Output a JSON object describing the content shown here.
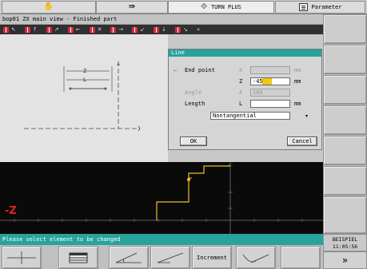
{
  "top_tabs": [
    {
      "icon": "hand-icon",
      "label": ""
    },
    {
      "icon": "program-icon",
      "label": ""
    },
    {
      "icon": "cycle-icon",
      "label": "TURN PLUS"
    },
    {
      "icon": "document-icon",
      "label": "Parameter"
    }
  ],
  "title_line": "bop01  ZX main view - Finished part",
  "dialog": {
    "title": "Line",
    "rows": [
      {
        "label": "End point",
        "letter": "X",
        "value": "",
        "unit": "mm",
        "dim": true
      },
      {
        "label": "",
        "letter": "Z",
        "value": "-45",
        "unit": "mm",
        "dim": false
      },
      {
        "label": "Angle",
        "letter": "A",
        "value": "180",
        "unit": "",
        "dim": true
      },
      {
        "label": "Length",
        "letter": "L",
        "value": "",
        "unit": "mm",
        "dim": false
      }
    ],
    "select_value": "Nontangential",
    "ok_label": "OK",
    "cancel_label": "Cancel"
  },
  "graphics": {
    "axis_label": "-Z",
    "contour_color": "#e8c02a",
    "axis_color": "#5d5d5d"
  },
  "status_message": "Please select element to be changed",
  "system": {
    "program": "BEISPIEL",
    "time": "11:05:56"
  },
  "bottom_keys": {
    "increment_label": "Increment"
  },
  "next_label": "»"
}
